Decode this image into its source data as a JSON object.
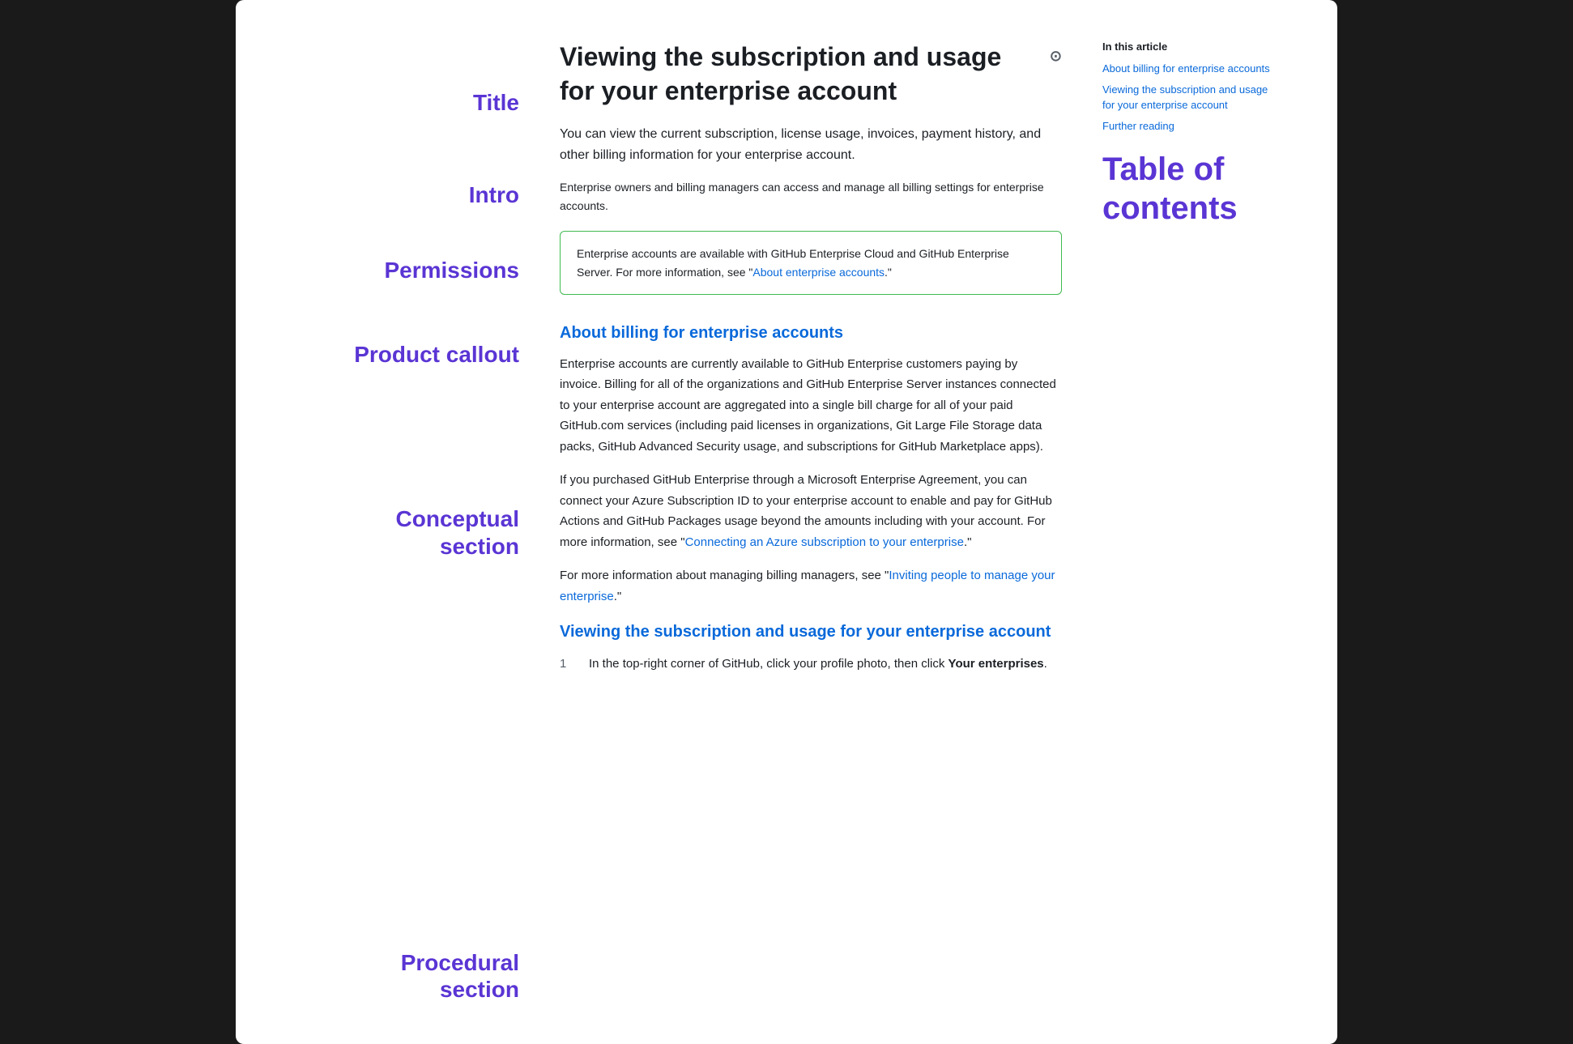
{
  "window": {
    "background": "#ffffff"
  },
  "annotations": {
    "title_label": "Title",
    "intro_label": "Intro",
    "permissions_label": "Permissions",
    "callout_label": "Product callout",
    "conceptual_label": "Conceptual\nsection",
    "procedural_label": "Procedural\nsection"
  },
  "article": {
    "title": "Viewing the subscription and usage for your enterprise account",
    "intro": "You can view the current subscription, license usage, invoices, payment history, and other billing information for your enterprise account.",
    "permissions": "Enterprise owners and billing managers can access and manage all billing settings for enterprise accounts.",
    "callout": {
      "text_before": "Enterprise accounts are available with GitHub Enterprise Cloud and GitHub Enterprise Server. For more information, see \"",
      "link_text": "About enterprise accounts",
      "text_after": ".\""
    },
    "conceptual_section": {
      "heading": "About billing for enterprise accounts",
      "paragraphs": [
        "Enterprise accounts are currently available to GitHub Enterprise customers paying by invoice. Billing for all of the organizations and GitHub Enterprise Server instances connected to your enterprise account are aggregated into a single bill charge for all of your paid GitHub.com services (including paid licenses in organizations, Git Large File Storage data packs, GitHub Advanced Security usage, and subscriptions for GitHub Marketplace apps).",
        {
          "text_before": "If you purchased GitHub Enterprise through a Microsoft Enterprise Agreement, you can connect your Azure Subscription ID to your enterprise account to enable and pay for GitHub Actions and GitHub Packages usage beyond the amounts including with your account. For more information, see \"",
          "link_text": "Connecting an Azure subscription to your enterprise",
          "text_after": ".\""
        },
        {
          "text_before": "For more information about managing billing managers, see \"",
          "link_text": "Inviting people to manage your enterprise",
          "text_after": ".\""
        }
      ]
    },
    "procedural_section": {
      "heading": "Viewing the subscription and usage for your enterprise account",
      "steps": [
        {
          "number": "1",
          "text_before": "In the top-right corner of GitHub, click your profile photo, then click ",
          "bold_text": "Your enterprises",
          "text_after": "."
        }
      ]
    }
  },
  "toc": {
    "in_article_label": "In this article",
    "links": [
      "About billing for enterprise accounts",
      "Viewing the subscription and usage for your enterprise account",
      "Further reading"
    ],
    "table_of_title": "Table of",
    "table_of_sub": "contents"
  },
  "icons": {
    "print": "⊙"
  }
}
